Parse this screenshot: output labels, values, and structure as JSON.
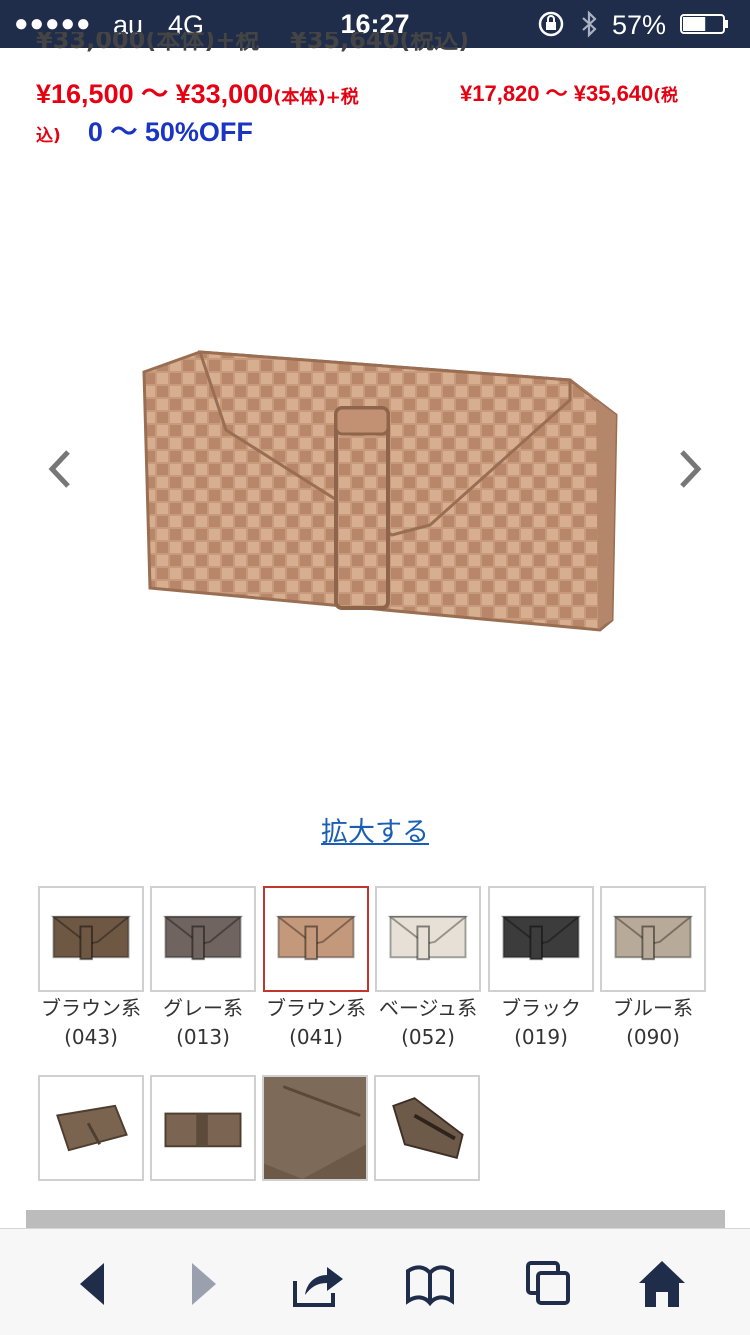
{
  "status_bar": {
    "signal": "●●●●●",
    "carrier": "au",
    "network": "4G",
    "time": "16:27",
    "battery_percent": "57%",
    "battery_level": 0.57
  },
  "price": {
    "cut_line_base": "¥33,000(本体)+税",
    "cut_line_tax": "¥35,640(税込)",
    "range_base_numbers": "¥16,500 〜 ¥33,000",
    "range_base_suffix": "(本体)+税",
    "range_tax_numbers": "¥17,820 〜 ¥35,640",
    "range_tax_suffix_start": "(税",
    "range_tax_suffix_end": "込)",
    "discount": "0 〜 50%OFF"
  },
  "enlarge_link": "拡大する",
  "color_variants": [
    {
      "name": "ブラウン系",
      "code": "(043)",
      "color": "#6e5844",
      "selected": false
    },
    {
      "name": "グレー系",
      "code": "(013)",
      "color": "#6f6460",
      "selected": false
    },
    {
      "name": "ブラウン系",
      "code": "(041)",
      "color": "#c4987a",
      "selected": true
    },
    {
      "name": "ベージュ系",
      "code": "(052)",
      "color": "#e6e0d6",
      "selected": false
    },
    {
      "name": "ブラック",
      "code": "(019)",
      "color": "#3c3c3c",
      "selected": false
    },
    {
      "name": "ブルー系",
      "code": "(090)",
      "color": "#b8aa98",
      "selected": false
    }
  ],
  "colors": {
    "price_red": "#e60012",
    "discount_blue": "#1a34c4",
    "link_blue": "#1a5fb4",
    "status_bar_bg": "#1f2d4a",
    "toolbar_icon": "#1f2d4a",
    "selected_border": "#c0362c"
  },
  "toolbar": {
    "icons": [
      "back-icon",
      "forward-icon",
      "share-icon",
      "bookmarks-icon",
      "tabs-icon",
      "home-icon"
    ]
  }
}
